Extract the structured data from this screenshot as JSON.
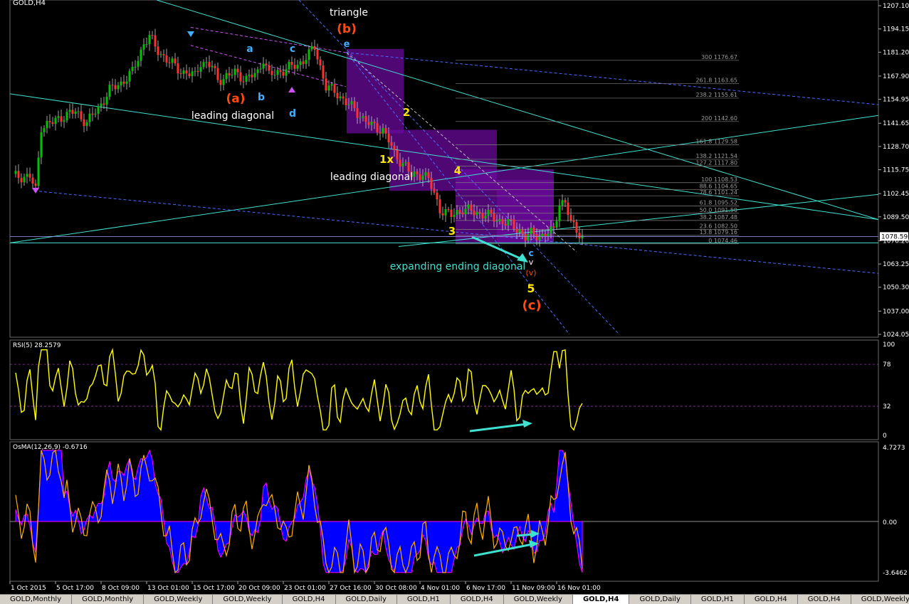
{
  "window": {
    "symbol_title": "GOLD,H4"
  },
  "colors": {
    "background": "#000000",
    "bull_candle": "#00c000",
    "bear_candle": "#ff3030",
    "wick": "#c8c8c8",
    "rsi_line": "#ffff00",
    "osma_hist": "#0000ff",
    "osma_signal": "#ffb000",
    "osma_outline": "#ff00ff",
    "cyan_line": "#40e0d0",
    "fib_line": "#808080",
    "dashed_blue": "#4a6cff",
    "annot_red": "#ff4a10",
    "annot_yellow": "#ffe400",
    "annot_blue": "#40b0ff",
    "annot_magenta": "#d050ff",
    "purple_box": "#6a0a9a"
  },
  "price_axis": {
    "ticks": [
      "1207.10",
      "1194.15",
      "1181.20",
      "1167.90",
      "1154.95",
      "1141.65",
      "1128.70",
      "1115.75",
      "1102.45",
      "1089.50",
      "1076.20",
      "1063.25",
      "1050.30",
      "1037.00",
      "1024.05"
    ],
    "current_price": "1078.59"
  },
  "time_axis": {
    "labels": [
      "1 Oct 2015",
      "5 Oct 17:00",
      "8 Oct 09:00",
      "13 Oct 01:00",
      "15 Oct 17:00",
      "20 Oct 09:00",
      "23 Oct 01:00",
      "27 Oct 16:00",
      "30 Oct 08:00",
      "4 Nov 01:00",
      "6 Nov 17:00",
      "11 Nov 09:00",
      "16 Nov 01:00"
    ]
  },
  "fib_levels": [
    {
      "pct": "300",
      "price": "1176.67"
    },
    {
      "pct": "261.8",
      "price": "1163.65"
    },
    {
      "pct": "238.2",
      "price": "1155.61"
    },
    {
      "pct": "200",
      "price": "1142.60"
    },
    {
      "pct": "161.8",
      "price": "1129.58"
    },
    {
      "pct": "138.2",
      "price": "1121.54"
    },
    {
      "pct": "127.2",
      "price": "1117.80"
    },
    {
      "pct": "100",
      "price": "1108.53"
    },
    {
      "pct": "88.6",
      "price": "1104.65"
    },
    {
      "pct": "78.6",
      "price": "1101.24"
    },
    {
      "pct": "61.8",
      "price": "1095.52"
    },
    {
      "pct": "50.0",
      "price": "1091.50"
    },
    {
      "pct": "38.2",
      "price": "1087.48"
    },
    {
      "pct": "23.6",
      "price": "1082.50"
    },
    {
      "pct": "13.8",
      "price": "1079.16"
    },
    {
      "pct": "0",
      "price": "1074.46"
    }
  ],
  "annotations": {
    "triangle": "triangle",
    "leading_diagonal_1": "leading diagonal",
    "leading_diagonal_2": "leading diagonal",
    "expanding_ending_diagonal": "expanding ending diagonal",
    "wave_b_big": "(b)",
    "wave_a_big": "(a)",
    "wave_c_big": "(c)",
    "wave_e": "e",
    "wave_a": "a",
    "wave_b": "b",
    "wave_c": "c",
    "wave_d": "d",
    "wave_1x": "1x",
    "wave_2": "2",
    "wave_3": "3",
    "wave_4": "4",
    "wave_5": "5",
    "wave_c_small": "c",
    "wave_v_small": "v",
    "wave_v_paren": "(v)"
  },
  "rsi": {
    "title": "RSI(5) 28.2579",
    "ticks": [
      "100",
      "78",
      "32",
      "0"
    ]
  },
  "osma": {
    "title": "OsMA(12,26,9) -0.6716",
    "ticks": [
      "4.7273",
      "0.00",
      "-3.6462"
    ]
  },
  "tabs": [
    "GOLD,Monthly",
    "GOLD,Monthly",
    "GOLD,Weekly",
    "GOLD,Weekly",
    "GOLD,H4",
    "GOLD,Daily",
    "GOLD,H1",
    "GOLD,H4",
    "GOLD,Weekly",
    "GOLD,H4",
    "GOLD,Daily",
    "GOLD,H1",
    "GOLD,H4",
    "GOLD,H4",
    "GOLD,Weekly"
  ],
  "active_tab_index": 9,
  "chart_data": {
    "type": "candlestick",
    "symbol": "GOLD",
    "timeframe": "H4",
    "ylim": [
      1020,
      1210
    ],
    "close_path": [
      [
        0,
        1112
      ],
      [
        6,
        1112
      ],
      [
        8,
        1104
      ],
      [
        10,
        1140
      ],
      [
        14,
        1142
      ],
      [
        18,
        1146
      ],
      [
        22,
        1148
      ],
      [
        26,
        1142
      ],
      [
        30,
        1150
      ],
      [
        34,
        1160
      ],
      [
        38,
        1164
      ],
      [
        42,
        1170
      ],
      [
        46,
        1186
      ],
      [
        48,
        1190
      ],
      [
        50,
        1184
      ],
      [
        54,
        1177
      ],
      [
        58,
        1172
      ],
      [
        60,
        1170
      ],
      [
        64,
        1168
      ],
      [
        66,
        1176
      ],
      [
        70,
        1173
      ],
      [
        72,
        1166
      ],
      [
        76,
        1168
      ],
      [
        78,
        1170
      ],
      [
        82,
        1166
      ],
      [
        86,
        1170
      ],
      [
        88,
        1178
      ],
      [
        90,
        1168
      ],
      [
        96,
        1172
      ],
      [
        100,
        1174
      ],
      [
        104,
        1180
      ],
      [
        106,
        1184
      ],
      [
        110,
        1162
      ],
      [
        114,
        1158
      ],
      [
        118,
        1152
      ],
      [
        122,
        1146
      ],
      [
        126,
        1140
      ],
      [
        130,
        1138
      ],
      [
        132,
        1132
      ],
      [
        134,
        1124
      ],
      [
        138,
        1118
      ],
      [
        140,
        1112
      ],
      [
        144,
        1114
      ],
      [
        146,
        1110
      ],
      [
        148,
        1102
      ],
      [
        150,
        1094
      ],
      [
        154,
        1090
      ],
      [
        158,
        1094
      ],
      [
        162,
        1092
      ],
      [
        166,
        1091
      ],
      [
        170,
        1088
      ],
      [
        174,
        1086
      ],
      [
        178,
        1082
      ],
      [
        180,
        1078
      ],
      [
        182,
        1080
      ],
      [
        186,
        1079
      ],
      [
        190,
        1082
      ],
      [
        192,
        1098
      ],
      [
        194,
        1097
      ],
      [
        196,
        1086
      ],
      [
        200,
        1079
      ]
    ]
  }
}
